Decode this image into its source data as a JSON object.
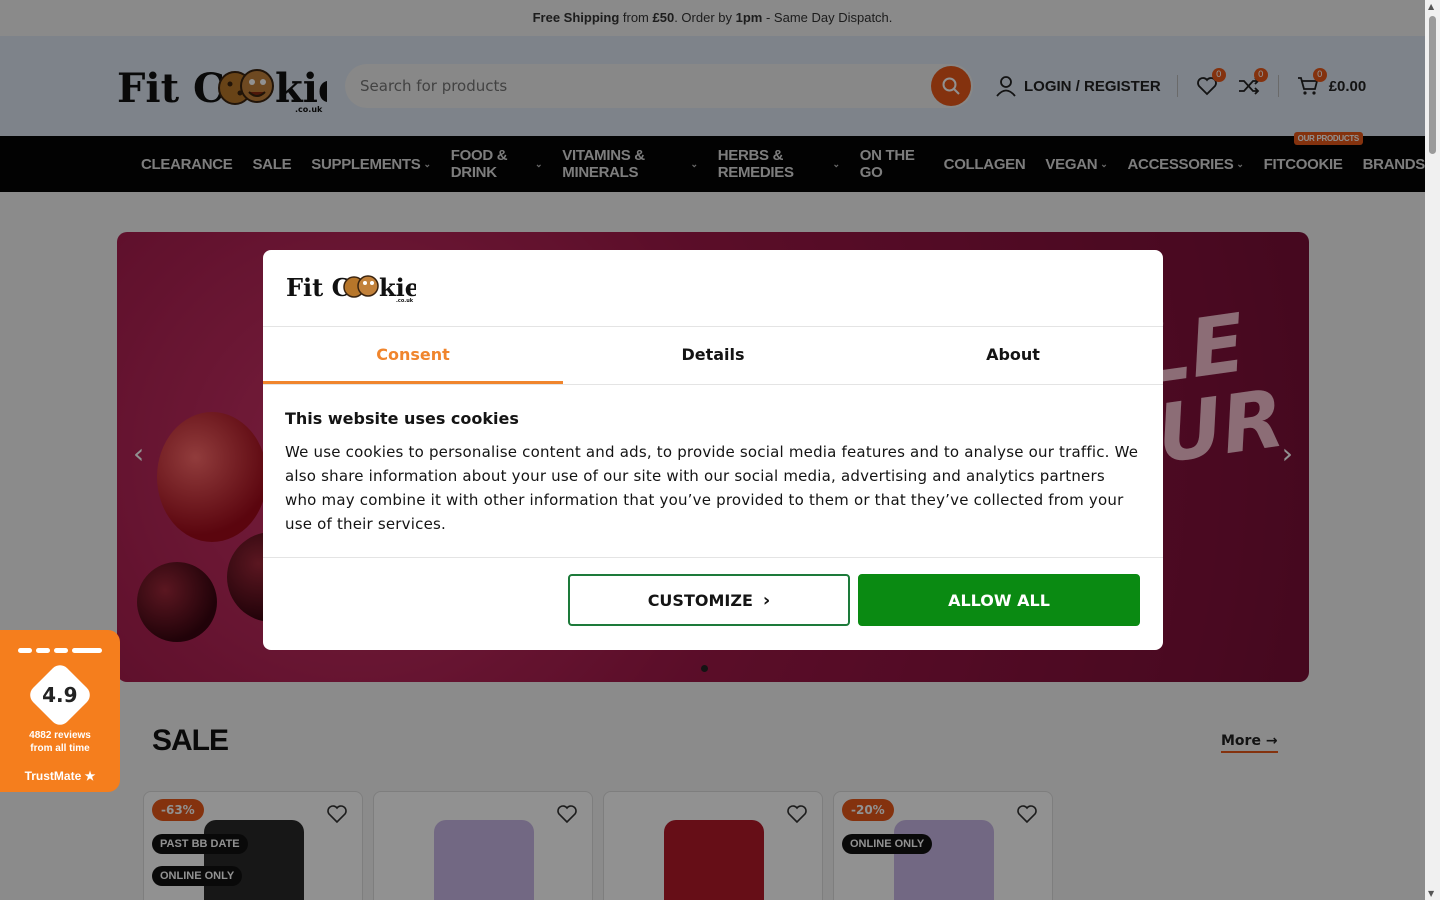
{
  "topbar": {
    "free": "Free Shipping",
    "from": " from ",
    "amount": "£50",
    "order_by": ". Order by ",
    "time": "1pm",
    "rest": " - Same Day Dispatch."
  },
  "logo": {
    "text": "Fit Cookie",
    "sub": ".co.uk"
  },
  "search": {
    "placeholder": "Search for products"
  },
  "header": {
    "login_label": "LOGIN / REGISTER",
    "wishlist_count": "0",
    "compare_count": "0",
    "cart_count": "0",
    "cart_total": "£0.00"
  },
  "nav": {
    "items": [
      {
        "label": "CLEARANCE",
        "caret": false
      },
      {
        "label": "SALE",
        "caret": false
      },
      {
        "label": "SUPPLEMENTS",
        "caret": true
      },
      {
        "label": "FOOD & DRINK",
        "caret": true
      },
      {
        "label": "VITAMINS & MINERALS",
        "caret": true
      },
      {
        "label": "HERBS & REMEDIES",
        "caret": true
      },
      {
        "label": "ON THE GO",
        "caret": false
      },
      {
        "label": "COLLAGEN",
        "caret": false
      },
      {
        "label": "VEGAN",
        "caret": true
      },
      {
        "label": "ACCESSORIES",
        "caret": true
      },
      {
        "label": "FITCOOKIE",
        "caret": false,
        "tag": "OUR PRODUCTS"
      },
      {
        "label": "BRANDS",
        "caret": false
      }
    ]
  },
  "hero": {
    "text_line1": "BLE",
    "text_line2": "OUR"
  },
  "sale": {
    "title": "SALE",
    "more": "More"
  },
  "products": [
    {
      "discount": "-63%",
      "labels": [
        "PAST BB DATE",
        "ONLINE ONLY"
      ],
      "color": "#2a2a2a"
    },
    {
      "discount": "",
      "labels": [],
      "color": "#c9b7e6"
    },
    {
      "discount": "",
      "labels": [],
      "color": "#b31a2a"
    },
    {
      "discount": "-20%",
      "labels": [
        "ONLINE ONLY"
      ],
      "color": "#c9b7e6"
    }
  ],
  "trust": {
    "score": "4.9",
    "reviews": "4882 reviews",
    "period": "from all time",
    "brand": "TrustMate"
  },
  "cookie": {
    "logo": "Fit Cookie",
    "tabs": [
      "Consent",
      "Details",
      "About"
    ],
    "heading": "This website uses cookies",
    "body": "We use cookies to personalise content and ads, to provide social media features and to analyse our traffic. We also share information about your use of our site with our social media, advertising and analytics partners who may combine it with other information that you’ve provided to them or that they’ve collected from your use of their services.",
    "customize": "CUSTOMIZE",
    "allow_all": "ALLOW ALL"
  },
  "colors": {
    "accent": "#e8581a",
    "tab_active": "#f0852d",
    "allow": "#0a8a12",
    "nav_bg": "#050505",
    "trust": "#f57e1d"
  }
}
